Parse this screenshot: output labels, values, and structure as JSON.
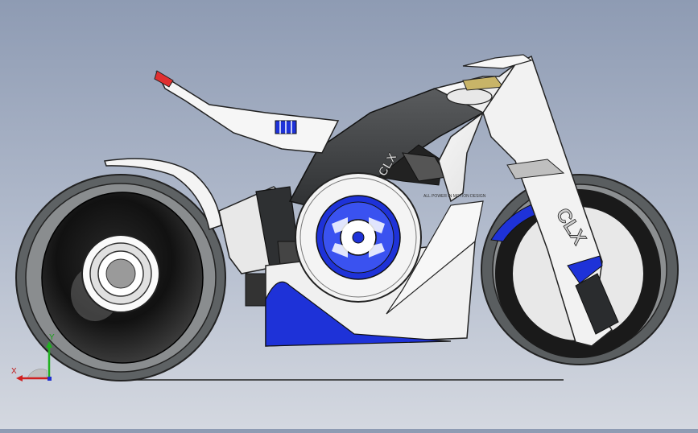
{
  "model": {
    "brand_rear": "CLX",
    "brand_front": "CLX",
    "side_text": "ALL POWER IN MOTION DESIGN"
  },
  "triad": {
    "x_label": "X",
    "y_label": "Y"
  },
  "colors": {
    "background_top": "#8e9bb3",
    "background_bottom": "#d4d8e0",
    "accent_blue": "#1e32d8",
    "body_white": "#f2f2f2",
    "frame_dark": "#3c3e40",
    "tire_black": "#1a1a1a",
    "axis_x": "#d02020",
    "axis_y": "#20b020"
  }
}
